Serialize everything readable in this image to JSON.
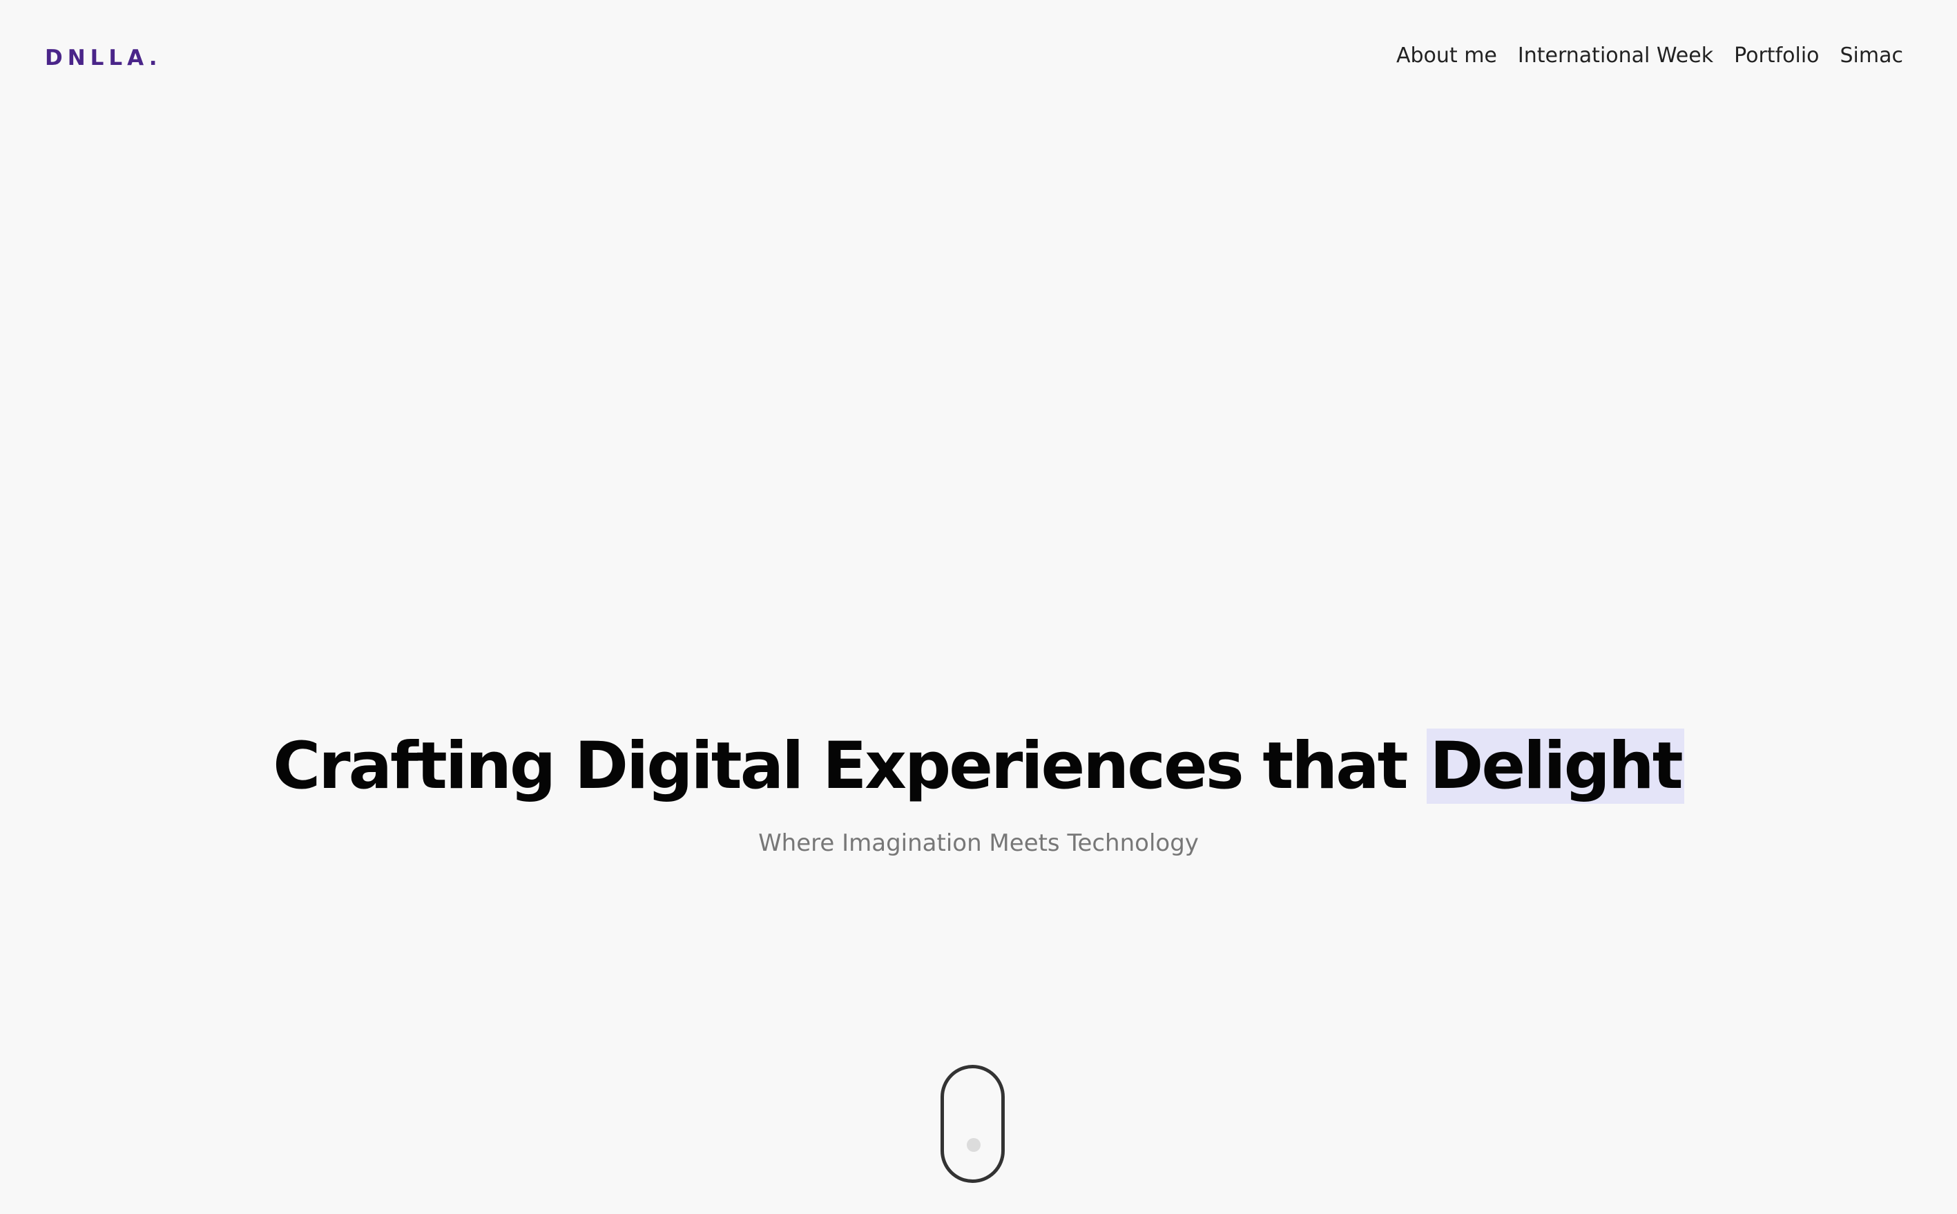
{
  "header": {
    "logo": "DNLLA.",
    "nav": [
      {
        "label": "About me"
      },
      {
        "label": "International Week"
      },
      {
        "label": "Portfolio"
      },
      {
        "label": "Simac"
      }
    ]
  },
  "hero": {
    "headline_main": "Crafting Digital Experiences that",
    "headline_highlight": "Delight",
    "subtitle": "Where Imagination Meets Technology"
  },
  "scroll_indicator": {
    "icon": "mouse-scroll-icon"
  },
  "colors": {
    "background": "#f8f8f8",
    "brand": "#4a2589",
    "highlight": "#e4e4f8",
    "heading": "#050505",
    "subtitle": "#777777"
  }
}
